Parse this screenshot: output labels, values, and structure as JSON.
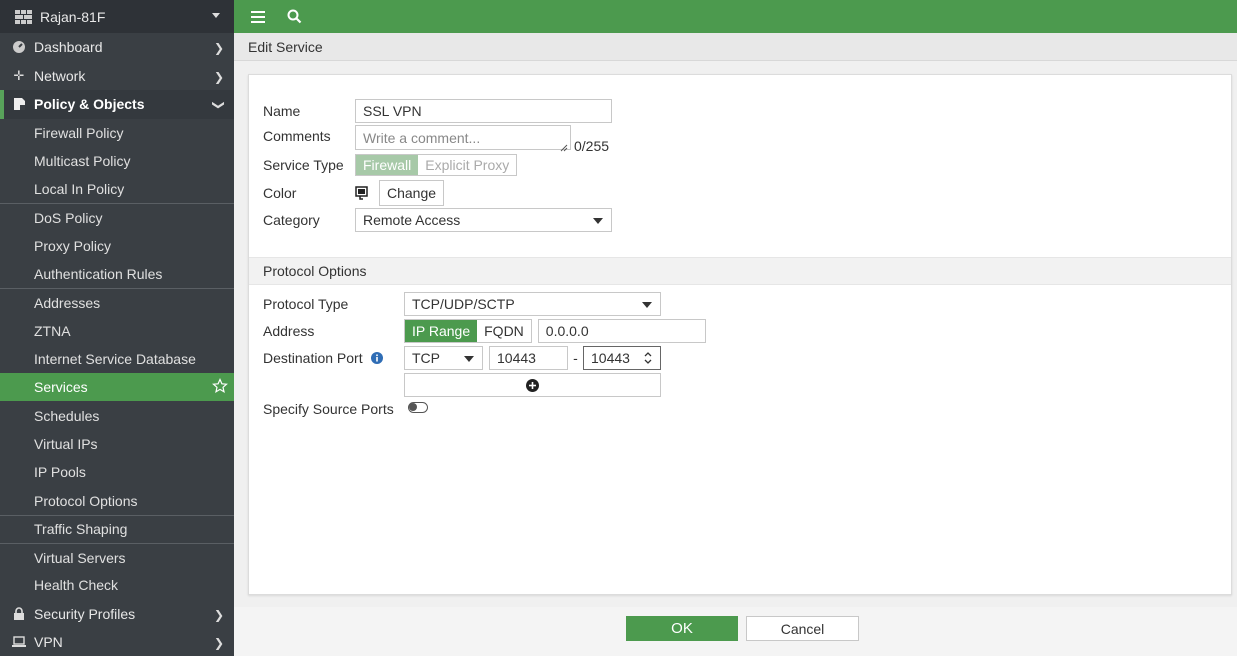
{
  "device": {
    "name": "Rajan-81F"
  },
  "sidebar": {
    "top": [
      {
        "label": "Dashboard",
        "icon": "dashboard-icon"
      },
      {
        "label": "Network",
        "icon": "network-icon"
      },
      {
        "label": "Policy & Objects",
        "icon": "policy-icon"
      }
    ],
    "sub": [
      {
        "label": "Firewall Policy"
      },
      {
        "label": "Multicast Policy"
      },
      {
        "label": "Local In Policy"
      },
      {
        "label": "DoS Policy"
      },
      {
        "label": "Proxy Policy"
      },
      {
        "label": "Authentication Rules"
      },
      {
        "label": "Addresses"
      },
      {
        "label": "ZTNA"
      },
      {
        "label": "Internet Service Database"
      },
      {
        "label": "Services"
      },
      {
        "label": "Schedules"
      },
      {
        "label": "Virtual IPs"
      },
      {
        "label": "IP Pools"
      },
      {
        "label": "Protocol Options"
      },
      {
        "label": "Traffic Shaping"
      },
      {
        "label": "Virtual Servers"
      },
      {
        "label": "Health Check"
      }
    ],
    "bottom": [
      {
        "label": "Security Profiles",
        "icon": "lock-icon"
      },
      {
        "label": "VPN",
        "icon": "laptop-icon"
      }
    ]
  },
  "page": {
    "title": "Edit Service"
  },
  "form": {
    "name_label": "Name",
    "name_value": "SSL VPN",
    "comments_label": "Comments",
    "comments_placeholder": "Write a comment...",
    "comments_count": "0/255",
    "service_type_label": "Service Type",
    "service_type_options": [
      "Firewall",
      "Explicit Proxy"
    ],
    "color_label": "Color",
    "color_button": "Change",
    "category_label": "Category",
    "category_value": "Remote Access",
    "protocol_section": "Protocol Options",
    "protocol_type_label": "Protocol Type",
    "protocol_type_value": "TCP/UDP/SCTP",
    "address_label": "Address",
    "address_options": [
      "IP Range",
      "FQDN"
    ],
    "address_value": "0.0.0.0",
    "dest_port_label": "Destination Port",
    "dest_protocol": "TCP",
    "dest_port_low": "10443",
    "dest_port_sep": "-",
    "dest_port_high": "10443",
    "source_ports_label": "Specify Source Ports"
  },
  "footer": {
    "ok": "OK",
    "cancel": "Cancel"
  },
  "colors": {
    "accent": "#4c9a4e",
    "sidebar": "#3a3f44"
  }
}
